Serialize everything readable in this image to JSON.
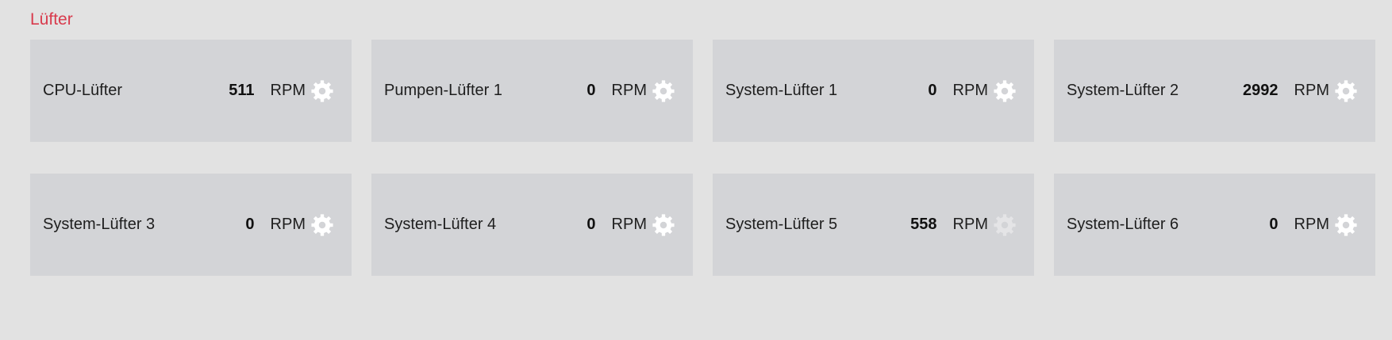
{
  "section": {
    "title": "Lüfter"
  },
  "fans": [
    {
      "name": "CPU-Lüfter",
      "value": "511",
      "unit": "RPM",
      "icon": "gear-icon",
      "icon_color": "#ffffff"
    },
    {
      "name": "Pumpen-Lüfter 1",
      "value": "0",
      "unit": "RPM",
      "icon": "gear-icon",
      "icon_color": "#ffffff"
    },
    {
      "name": "System-Lüfter 1",
      "value": "0",
      "unit": "RPM",
      "icon": "gear-icon",
      "icon_color": "#ffffff"
    },
    {
      "name": "System-Lüfter 2",
      "value": "2992",
      "unit": "RPM",
      "icon": "gear-icon",
      "icon_color": "#ffffff"
    },
    {
      "name": "System-Lüfter 3",
      "value": "0",
      "unit": "RPM",
      "icon": "gear-icon",
      "icon_color": "#ffffff"
    },
    {
      "name": "System-Lüfter 4",
      "value": "0",
      "unit": "RPM",
      "icon": "gear-icon",
      "icon_color": "#ffffff"
    },
    {
      "name": "System-Lüfter 5",
      "value": "558",
      "unit": "RPM",
      "icon": "gear-icon",
      "icon_color": "#e4e4e6"
    },
    {
      "name": "System-Lüfter 6",
      "value": "0",
      "unit": "RPM",
      "icon": "gear-icon",
      "icon_color": "#ffffff"
    }
  ],
  "colors": {
    "background": "#e2e2e2",
    "card": "#d3d4d7",
    "title": "#d83a4c"
  }
}
